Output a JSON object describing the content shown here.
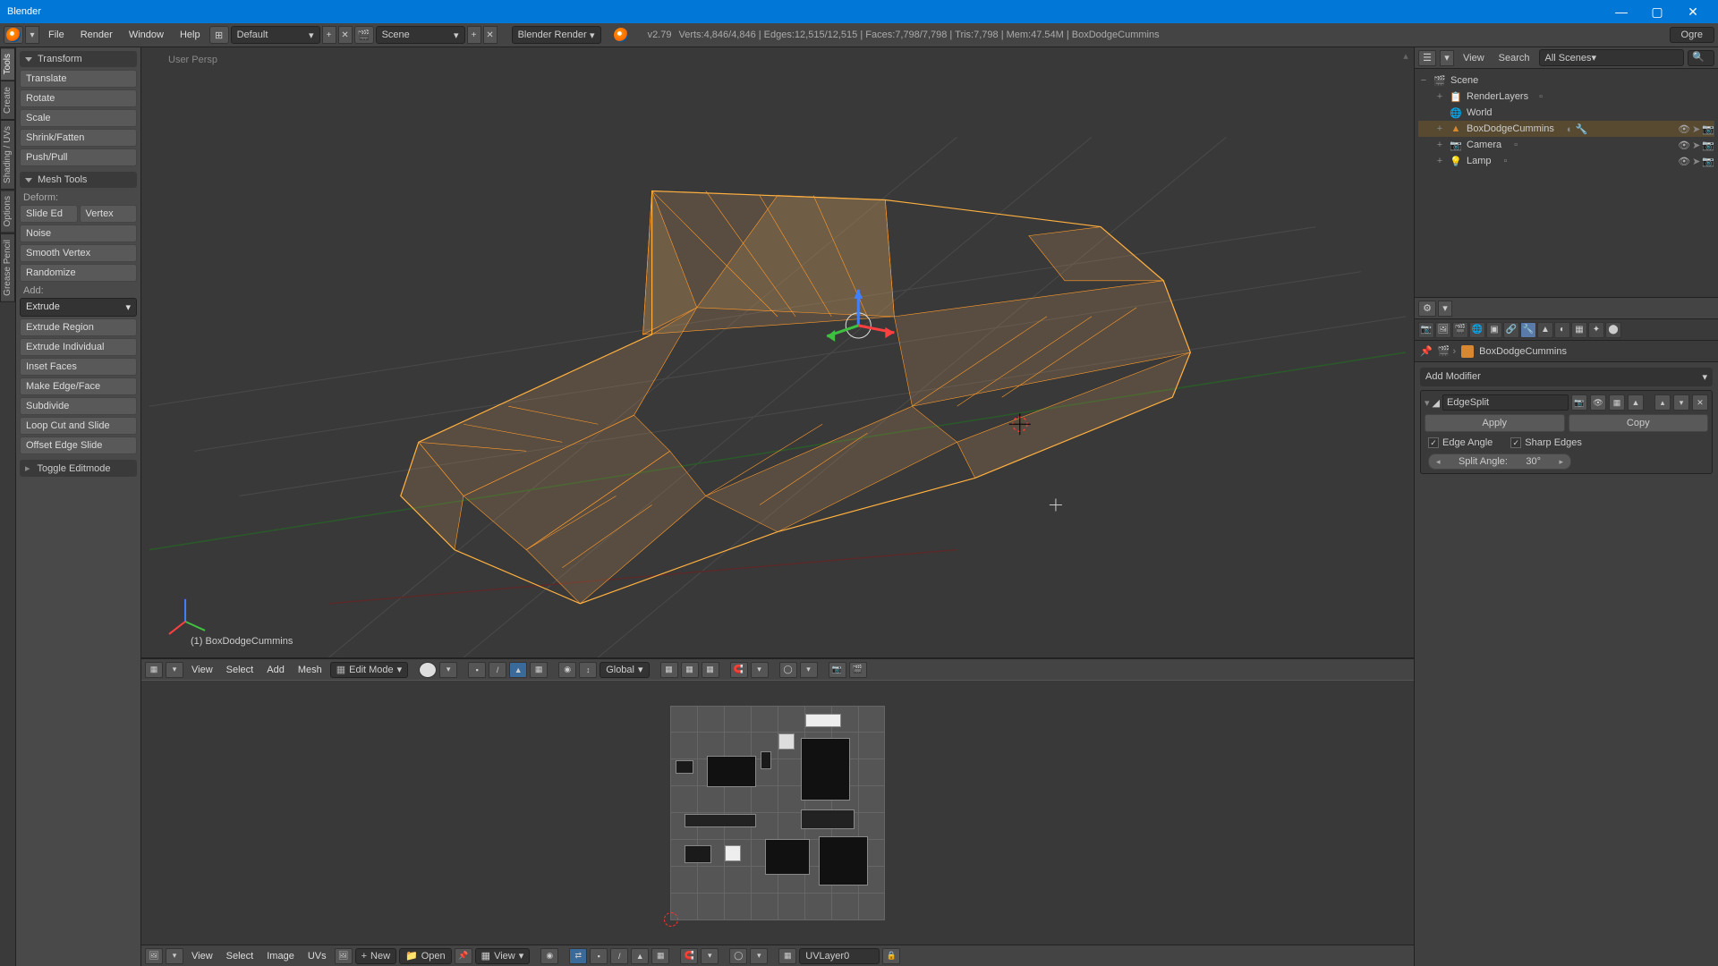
{
  "app": {
    "title": "Blender"
  },
  "window_buttons": {
    "min": "—",
    "max": "▢",
    "close": "✕"
  },
  "menu": {
    "file": "File",
    "render": "Render",
    "window": "Window",
    "help": "Help"
  },
  "header": {
    "layout_label": "Default",
    "scene_icon": "🎬",
    "scene_label": "Scene",
    "engine": "Blender Render",
    "version": "v2.79",
    "ogre": "Ogre",
    "stats": "Verts:4,846/4,846 | Edges:12,515/12,515 | Faces:7,798/7,798 | Tris:7,798 | Mem:47.54M | BoxDodgeCummins"
  },
  "lefttabs": {
    "tools": "Tools",
    "create": "Create",
    "shading": "Shading / UVs",
    "options": "Options",
    "grease": "Grease Pencil"
  },
  "toolpanel": {
    "transform_head": "Transform",
    "translate": "Translate",
    "rotate": "Rotate",
    "scale": "Scale",
    "shrink": "Shrink/Fatten",
    "pushpull": "Push/Pull",
    "mesh_head": "Mesh Tools",
    "deform_label": "Deform:",
    "slideed": "Slide Ed",
    "vertex": "Vertex",
    "noise": "Noise",
    "smoothv": "Smooth Vertex",
    "randomize": "Randomize",
    "add_label": "Add:",
    "extrude": "Extrude",
    "extruder": "Extrude Region",
    "extrudei": "Extrude Individual",
    "inset": "Inset Faces",
    "makeedge": "Make Edge/Face",
    "subdivide": "Subdivide",
    "loopcut": "Loop Cut and Slide",
    "offset": "Offset Edge Slide",
    "toggle_head": "Toggle Editmode"
  },
  "viewport": {
    "persp": "User Persp",
    "objname_prefix": "(1) ",
    "objname": "BoxDodgeCummins",
    "header": {
      "view": "View",
      "select": "Select",
      "add": "Add",
      "mesh": "Mesh",
      "mode": "Edit Mode",
      "orientation": "Global"
    }
  },
  "uveditor": {
    "header": {
      "view": "View",
      "select": "Select",
      "image": "Image",
      "uvs": "UVs",
      "new": "New",
      "open": "Open",
      "viewmenu": "View",
      "layer": "UVLayer0"
    }
  },
  "outliner": {
    "head": {
      "view": "View",
      "search": "Search",
      "filter": "All Scenes"
    },
    "tree": {
      "scene": "Scene",
      "renderlayers": "RenderLayers",
      "world": "World",
      "object": "BoxDodgeCummins",
      "camera": "Camera",
      "lamp": "Lamp"
    }
  },
  "properties": {
    "breadcrumb": "BoxDodgeCummins",
    "add_modifier": "Add Modifier",
    "modifier": {
      "name": "EdgeSplit",
      "apply": "Apply",
      "copy": "Copy",
      "edge_angle": "Edge Angle",
      "sharp_edges": "Sharp Edges",
      "split_angle_label": "Split Angle:",
      "split_angle": "30°"
    }
  }
}
